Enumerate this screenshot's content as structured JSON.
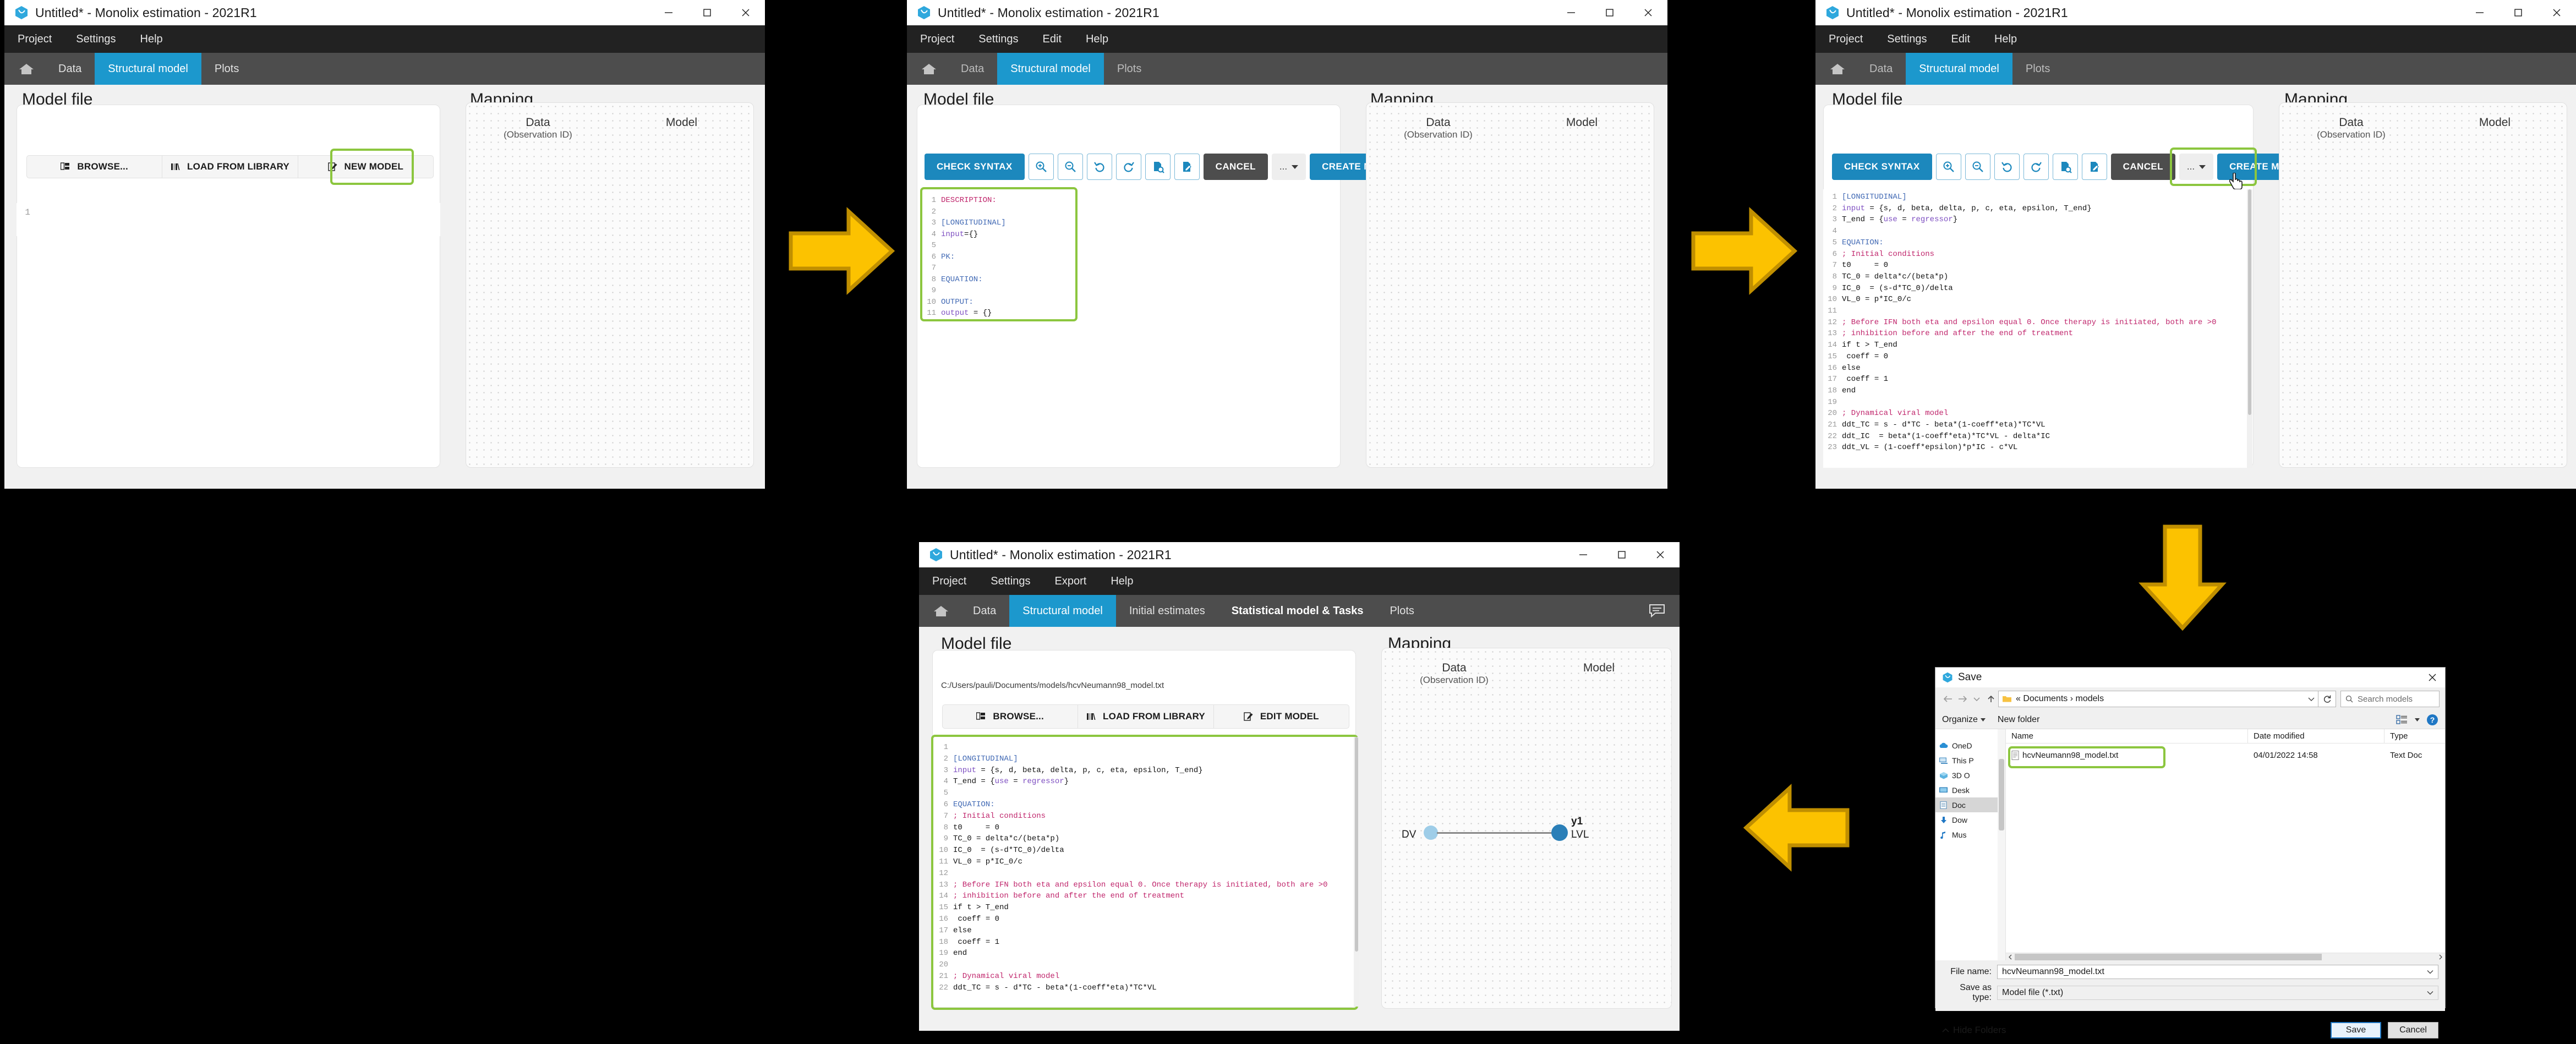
{
  "window": {
    "title": "Untitled* - Monolix estimation - 2021R1",
    "controls": {
      "minimize": "minimize-icon",
      "maximize": "maximize-icon",
      "close": "close-icon"
    }
  },
  "panel1": {
    "menu": [
      "Project",
      "Settings",
      "Help"
    ],
    "tabs": [
      {
        "label": "home-icon",
        "active": false,
        "home": true
      },
      {
        "label": "Data",
        "active": false
      },
      {
        "label": "Structural model",
        "active": true
      },
      {
        "label": "Plots",
        "active": false
      }
    ],
    "model_file_title": "Model file",
    "mapping_title": "Mapping",
    "mapping_cols": [
      {
        "line1": "Data",
        "line2": "(Observation ID)"
      },
      {
        "line1": "Model",
        "line2": ""
      }
    ],
    "filebar": [
      {
        "label": "BROWSE...",
        "icon": "browse-folder-icon"
      },
      {
        "label": "LOAD FROM LIBRARY",
        "icon": "library-icon"
      },
      {
        "label": "NEW MODEL",
        "icon": "edit-pencil-icon"
      }
    ],
    "editor_lines": [
      {
        "n": "1",
        "text": ""
      }
    ]
  },
  "panel2": {
    "menu": [
      "Project",
      "Settings",
      "Edit",
      "Help"
    ],
    "tabs": [
      {
        "label": "home-icon",
        "active": false,
        "home": true
      },
      {
        "label": "Data",
        "active": false,
        "dim": true
      },
      {
        "label": "Structural model",
        "active": true
      },
      {
        "label": "Plots",
        "active": false,
        "dim": true
      }
    ],
    "model_file_title": "Model file",
    "mapping_title": "Mapping",
    "mapping_cols": [
      {
        "line1": "Data",
        "line2": "(Observation ID)"
      },
      {
        "line1": "Model",
        "line2": ""
      }
    ],
    "toolbar": {
      "check_syntax": "CHECK SYNTAX",
      "zoom_in": "zoom-in-icon",
      "zoom_out": "zoom-out-icon",
      "undo": "undo-icon",
      "redo": "redo-icon",
      "preview": "document-search-icon",
      "edit": "document-edit-icon",
      "cancel": "CANCEL",
      "more": "...",
      "create_model": "CREATE MODEL"
    },
    "editor_lines": [
      {
        "n": "1",
        "segs": [
          {
            "t": "DESCRIPTION:",
            "c": "k-pink"
          }
        ]
      },
      {
        "n": "2",
        "segs": []
      },
      {
        "n": "3",
        "segs": [
          {
            "t": "[LONGITUDINAL]",
            "c": "k-blue"
          }
        ]
      },
      {
        "n": "4",
        "segs": [
          {
            "t": "input",
            "c": "k-purple"
          },
          {
            "t": "={}",
            "c": "k-black"
          }
        ]
      },
      {
        "n": "5",
        "segs": []
      },
      {
        "n": "6",
        "segs": [
          {
            "t": "PK:",
            "c": "k-blue"
          }
        ]
      },
      {
        "n": "7",
        "segs": []
      },
      {
        "n": "8",
        "segs": [
          {
            "t": "EQUATION:",
            "c": "k-blue"
          }
        ]
      },
      {
        "n": "9",
        "segs": []
      },
      {
        "n": "10",
        "segs": [
          {
            "t": "OUTPUT:",
            "c": "k-blue"
          }
        ]
      },
      {
        "n": "11",
        "segs": [
          {
            "t": "output",
            "c": "k-purple"
          },
          {
            "t": " = {}",
            "c": "k-black"
          }
        ]
      }
    ]
  },
  "panel3": {
    "menu": [
      "Project",
      "Settings",
      "Edit",
      "Help"
    ],
    "tabs": [
      {
        "label": "home-icon",
        "active": false,
        "home": true
      },
      {
        "label": "Data",
        "active": false,
        "dim": true
      },
      {
        "label": "Structural model",
        "active": true
      },
      {
        "label": "Plots",
        "active": false,
        "dim": true
      }
    ],
    "model_file_title": "Model file",
    "mapping_title": "Mapping",
    "mapping_cols": [
      {
        "line1": "Data",
        "line2": "(Observation ID)"
      },
      {
        "line1": "Model",
        "line2": ""
      }
    ],
    "toolbar": {
      "check_syntax": "CHECK SYNTAX",
      "zoom_in": "zoom-in-icon",
      "zoom_out": "zoom-out-icon",
      "undo": "undo-icon",
      "redo": "redo-icon",
      "preview": "document-search-icon",
      "edit": "document-edit-icon",
      "cancel": "CANCEL",
      "more": "...",
      "create_model": "CREATE MODEL"
    },
    "editor_lines": [
      {
        "n": "1",
        "segs": [
          {
            "t": "[LONGITUDINAL]",
            "c": "k-blue"
          }
        ]
      },
      {
        "n": "2",
        "segs": [
          {
            "t": "input",
            "c": "k-purple"
          },
          {
            "t": " = {s, d, beta, delta, p, c, eta, epsilon, T_end}",
            "c": "k-black"
          }
        ]
      },
      {
        "n": "3",
        "segs": [
          {
            "t": "T_end = {",
            "c": "k-black"
          },
          {
            "t": "use",
            "c": "k-purple"
          },
          {
            "t": " = ",
            "c": "k-black"
          },
          {
            "t": "regressor",
            "c": "k-purple"
          },
          {
            "t": "}",
            "c": "k-black"
          }
        ]
      },
      {
        "n": "4",
        "segs": []
      },
      {
        "n": "5",
        "segs": [
          {
            "t": "EQUATION:",
            "c": "k-blue"
          }
        ]
      },
      {
        "n": "6",
        "segs": [
          {
            "t": "; Initial conditions",
            "c": "k-pink"
          }
        ]
      },
      {
        "n": "7",
        "segs": [
          {
            "t": "t0     = 0",
            "c": "k-black"
          }
        ]
      },
      {
        "n": "8",
        "segs": [
          {
            "t": "TC_0 = delta*c/(beta*p)",
            "c": "k-black"
          }
        ]
      },
      {
        "n": "9",
        "segs": [
          {
            "t": "IC_0  = (s-d*TC_0)/delta",
            "c": "k-black"
          }
        ]
      },
      {
        "n": "10",
        "segs": [
          {
            "t": "VL_0 = p*IC_0/c",
            "c": "k-black"
          }
        ]
      },
      {
        "n": "11",
        "segs": []
      },
      {
        "n": "12",
        "segs": [
          {
            "t": "; Before IFN both eta and epsilon equal 0. Once therapy is initiated, both are >0",
            "c": "k-pink"
          }
        ]
      },
      {
        "n": "13",
        "segs": [
          {
            "t": "; inhibition before and after the end of treatment",
            "c": "k-pink"
          }
        ]
      },
      {
        "n": "14",
        "segs": [
          {
            "t": "if t > T_end",
            "c": "k-black"
          }
        ]
      },
      {
        "n": "15",
        "segs": [
          {
            "t": " coeff = 0",
            "c": "k-black"
          }
        ]
      },
      {
        "n": "16",
        "segs": [
          {
            "t": "else",
            "c": "k-black"
          }
        ]
      },
      {
        "n": "17",
        "segs": [
          {
            "t": " coeff = 1",
            "c": "k-black"
          }
        ]
      },
      {
        "n": "18",
        "segs": [
          {
            "t": "end",
            "c": "k-black"
          }
        ]
      },
      {
        "n": "19",
        "segs": []
      },
      {
        "n": "20",
        "segs": [
          {
            "t": "; Dynamical viral model",
            "c": "k-pink"
          }
        ]
      },
      {
        "n": "21",
        "segs": [
          {
            "t": "ddt_TC = s - d*TC - beta*(1-coeff*eta)*TC*VL",
            "c": "k-black"
          }
        ]
      },
      {
        "n": "22",
        "segs": [
          {
            "t": "ddt_IC  = beta*(1-coeff*eta)*TC*VL - delta*IC",
            "c": "k-black"
          }
        ]
      },
      {
        "n": "23",
        "segs": [
          {
            "t": "ddt_VL = (1-coeff*epsilon)*p*IC - c*VL",
            "c": "k-black"
          }
        ]
      }
    ]
  },
  "panel4": {
    "menu": [
      "Project",
      "Settings",
      "Export",
      "Help"
    ],
    "tabs": [
      {
        "label": "home-icon",
        "active": false,
        "home": true
      },
      {
        "label": "Data",
        "active": false
      },
      {
        "label": "Structural model",
        "active": true
      },
      {
        "label": "Initial estimates",
        "active": false
      },
      {
        "label": "Statistical model & Tasks",
        "active": false,
        "bold": true
      },
      {
        "label": "Plots",
        "active": false
      }
    ],
    "comment_icon": "comment-icon",
    "model_file_title": "Model file",
    "model_path": "C:/Users/pauli/Documents/models/hcvNeumann98_model.txt",
    "mapping_title": "Mapping",
    "mapping_cols": [
      {
        "line1": "Data",
        "line2": "(Observation ID)"
      },
      {
        "line1": "Model",
        "line2": ""
      }
    ],
    "filebar": [
      {
        "label": "BROWSE...",
        "icon": "browse-folder-icon"
      },
      {
        "label": "LOAD FROM LIBRARY",
        "icon": "library-icon"
      },
      {
        "label": "EDIT MODEL",
        "icon": "edit-pencil-icon"
      }
    ],
    "mapping_link": {
      "left_label": "DV",
      "right_label": "LVL",
      "right_top_label": "y1"
    },
    "editor_lines": [
      {
        "n": "1",
        "segs": []
      },
      {
        "n": "2",
        "segs": [
          {
            "t": "[LONGITUDINAL]",
            "c": "k-blue"
          }
        ]
      },
      {
        "n": "3",
        "segs": [
          {
            "t": "input",
            "c": "k-purple"
          },
          {
            "t": " = {s, d, beta, delta, p, c, eta, epsilon, T_end}",
            "c": "k-black"
          }
        ]
      },
      {
        "n": "4",
        "segs": [
          {
            "t": "T_end = {",
            "c": "k-black"
          },
          {
            "t": "use",
            "c": "k-purple"
          },
          {
            "t": " = ",
            "c": "k-black"
          },
          {
            "t": "regressor",
            "c": "k-purple"
          },
          {
            "t": "}",
            "c": "k-black"
          }
        ]
      },
      {
        "n": "5",
        "segs": []
      },
      {
        "n": "6",
        "segs": [
          {
            "t": "EQUATION:",
            "c": "k-blue"
          }
        ]
      },
      {
        "n": "7",
        "segs": [
          {
            "t": "; Initial conditions",
            "c": "k-pink"
          }
        ]
      },
      {
        "n": "8",
        "segs": [
          {
            "t": "t0     = 0",
            "c": "k-black"
          }
        ]
      },
      {
        "n": "9",
        "segs": [
          {
            "t": "TC_0 = delta*c/(beta*p)",
            "c": "k-black"
          }
        ]
      },
      {
        "n": "10",
        "segs": [
          {
            "t": "IC_0  = (s-d*TC_0)/delta",
            "c": "k-black"
          }
        ]
      },
      {
        "n": "11",
        "segs": [
          {
            "t": "VL_0 = p*IC_0/c",
            "c": "k-black"
          }
        ]
      },
      {
        "n": "12",
        "segs": []
      },
      {
        "n": "13",
        "segs": [
          {
            "t": "; Before IFN both eta and epsilon equal 0. Once therapy is initiated, both are >0",
            "c": "k-pink"
          }
        ]
      },
      {
        "n": "14",
        "segs": [
          {
            "t": "; inhibition before and after the end of treatment",
            "c": "k-pink"
          }
        ]
      },
      {
        "n": "15",
        "segs": [
          {
            "t": "if t > T_end",
            "c": "k-black"
          }
        ]
      },
      {
        "n": "16",
        "segs": [
          {
            "t": " coeff = 0",
            "c": "k-black"
          }
        ]
      },
      {
        "n": "17",
        "segs": [
          {
            "t": "else",
            "c": "k-black"
          }
        ]
      },
      {
        "n": "18",
        "segs": [
          {
            "t": " coeff = 1",
            "c": "k-black"
          }
        ]
      },
      {
        "n": "19",
        "segs": [
          {
            "t": "end",
            "c": "k-black"
          }
        ]
      },
      {
        "n": "20",
        "segs": []
      },
      {
        "n": "21",
        "segs": [
          {
            "t": "; Dynamical viral model",
            "c": "k-pink"
          }
        ]
      },
      {
        "n": "22",
        "segs": [
          {
            "t": "ddt_TC = s - d*TC - beta*(1-coeff*eta)*TC*VL",
            "c": "k-black"
          }
        ]
      }
    ]
  },
  "save_dialog": {
    "title": "Save",
    "breadcrumb": "« Documents  ›  models",
    "search_placeholder": "Search models",
    "organize": "Organize",
    "new_folder": "New folder",
    "columns": [
      "Name",
      "Date modified",
      "Type"
    ],
    "rows": [
      {
        "name": "hcvNeumann98_model.txt",
        "date": "04/01/2022 14:58",
        "type": "Text Doc",
        "icon": "text-file-icon",
        "highlighted": true
      }
    ],
    "nav_items": [
      {
        "label": "OneD",
        "icon": "onedrive-icon",
        "selected": false
      },
      {
        "label": "This P",
        "icon": "this-pc-icon",
        "selected": false
      },
      {
        "label": "3D O",
        "icon": "3d-objects-icon",
        "selected": false
      },
      {
        "label": "Desk",
        "icon": "desktop-icon",
        "selected": false
      },
      {
        "label": "Doc",
        "icon": "documents-icon",
        "selected": true
      },
      {
        "label": "Dow",
        "icon": "downloads-icon",
        "selected": false
      },
      {
        "label": "Mus",
        "icon": "music-icon",
        "selected": false
      }
    ],
    "file_name_label": "File name:",
    "file_name_value": "hcvNeumann98_model.txt",
    "save_as_type_label": "Save as type:",
    "save_as_type_value": "Model file (*.txt)",
    "hide_folders": "Hide Folders",
    "save_button": "Save",
    "cancel_button": "Cancel"
  },
  "arrows": [
    {
      "dir": "right",
      "name": "flow-arrow-1"
    },
    {
      "dir": "right",
      "name": "flow-arrow-2"
    },
    {
      "dir": "down",
      "name": "flow-arrow-3"
    },
    {
      "dir": "left",
      "name": "flow-arrow-4"
    }
  ],
  "colors": {
    "accent": "#1c88bd",
    "tab_active": "#1c98cd",
    "highlight": "#8cc63f",
    "arrow_fill": "#fcc200",
    "arrow_stroke": "#c08f00",
    "menubar": "#222222",
    "tabbar": "#4d4d4d"
  }
}
